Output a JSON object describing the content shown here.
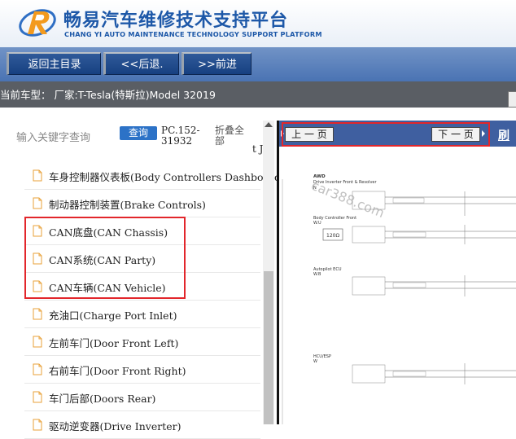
{
  "header": {
    "title_cn": "畅易汽车维修技术支持平台",
    "title_en": "CHANG YI AUTO MAINTENANCE TECHNOLOGY SUPPORT PLATFORM",
    "logo_icon": "r-swoosh-logo"
  },
  "toolbar": {
    "home_label": "返回主目录",
    "back_label": "<<后退.",
    "forward_label": ">>前进"
  },
  "model": {
    "text": "当前车型： 厂家:T-Tesla(特斯拉)Model 32019"
  },
  "search": {
    "placeholder": "输入关键字查询",
    "button_label": "查询",
    "pc_code": "PC.152-31932",
    "collapse_label": "折叠全部",
    "truncated": "t J"
  },
  "tree": {
    "items": [
      {
        "label": "车身控制器仪表板(Body Controllers Dashboard"
      },
      {
        "label": "制动器控制装置(Brake Controls)"
      },
      {
        "label": "CAN底盘(CAN Chassis)"
      },
      {
        "label": "CAN系统(CAN Party)"
      },
      {
        "label": "CAN车辆(CAN Vehicle)"
      },
      {
        "label": "充油口(Charge Port Inlet)"
      },
      {
        "label": "左前车门(Door Front Left)"
      },
      {
        "label": "右前车门(Door Front Right)"
      },
      {
        "label": "车门后部(Doors Rear)"
      },
      {
        "label": "驱动逆变器(Drive Inverter)"
      }
    ]
  },
  "viewer": {
    "prev_label": "上 一 页",
    "next_label": "下 一 页",
    "refresh_label": "刷",
    "watermark": "car388.com",
    "sections": [
      {
        "title": "AWD",
        "subtitle": "Drive Inverter Front & Resolver",
        "code": "N"
      },
      {
        "title": "Body Controller Front",
        "code": "W.U",
        "resistor": "120Ω"
      },
      {
        "title": "Autopilot ECU",
        "code": "W.B"
      },
      {
        "title": "HCU/ESP",
        "code": "W"
      }
    ]
  },
  "colors": {
    "brand_blue": "#1d58a8",
    "toolbar_blue": "#4a73b3",
    "highlight_red": "#e2262b"
  }
}
